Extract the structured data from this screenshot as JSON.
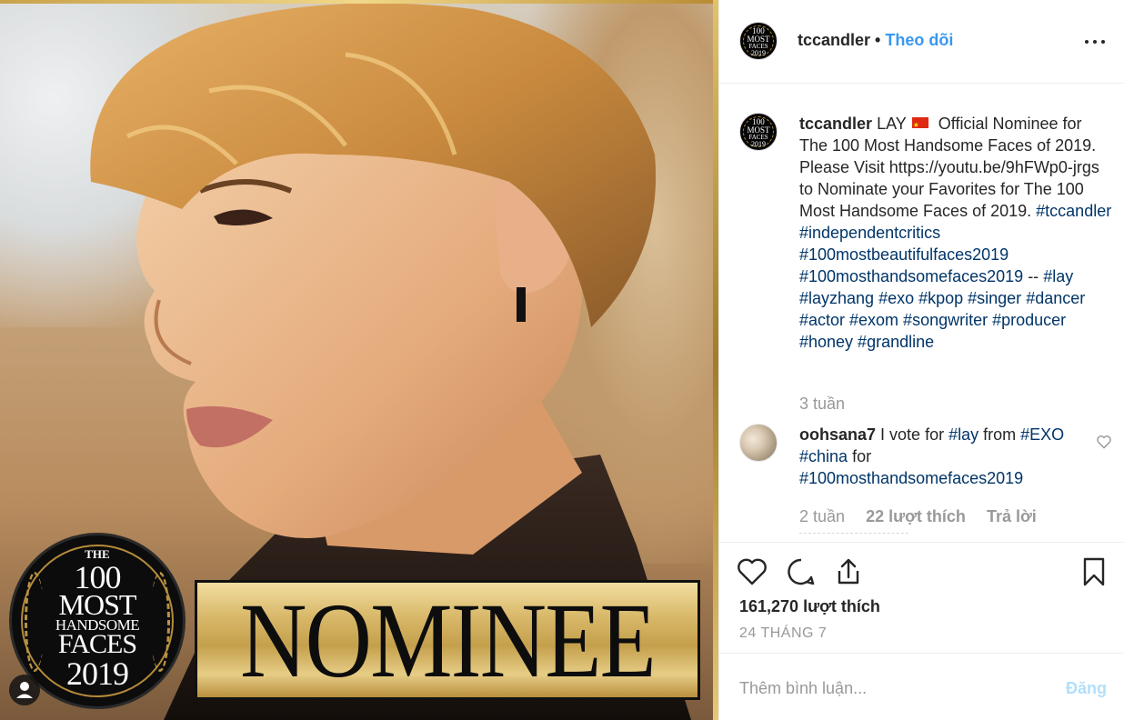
{
  "header": {
    "username": "tccandler",
    "separator": "•",
    "follow_label": "Theo dõi"
  },
  "media": {
    "plate_text": "NOMINEE",
    "seal": {
      "the": "THE",
      "hundred": "100",
      "most": "MOST",
      "handsome": "HANDSOME",
      "faces": "FACES",
      "year": "2019"
    }
  },
  "caption": {
    "username": "tccandler",
    "text_before_flag": "LAY",
    "flag_icon": "china-flag-icon",
    "text": "Official Nominee for The 100 Most Handsome Faces of 2019. Please Visit https://youtu.be/9hFWp0-jrgs to Nominate your Favorites for The 100 Most Handsome Faces of 2019.",
    "hashtags_line1": "#tccandler #independentcritics",
    "hashtags_line2": "#100mostbeautifulfaces2019",
    "hashtags_line3": "#100mosthandsomefaces2019",
    "dashes": " --",
    "hashtags_line4": "#lay #layzhang #exo #kpop #singer",
    "hashtags_line5": "#dancer #actor #exom #songwriter",
    "hashtags_line6": "#producer #honey #grandline",
    "time": "3 tuần"
  },
  "comment": {
    "username": "oohsana7",
    "text_1": "I vote for",
    "tag_1": "#lay",
    "text_2": "from",
    "tag_2": "#EXO",
    "tag_3": "#china",
    "text_3": "for",
    "tag_4": "#100mosthandsomefaces2019",
    "time": "2 tuần",
    "likes": "22 lượt thích",
    "reply": "Trả lời"
  },
  "actions": {
    "likes_count": "161,270 lượt thích",
    "date": "24 THÁNG 7"
  },
  "add_comment": {
    "placeholder": "Thêm bình luận...",
    "post_label": "Đăng"
  },
  "colors": {
    "link_blue": "#3897f0",
    "hashtag": "#003569",
    "muted": "#999999",
    "post_disabled": "#b2dffc"
  }
}
